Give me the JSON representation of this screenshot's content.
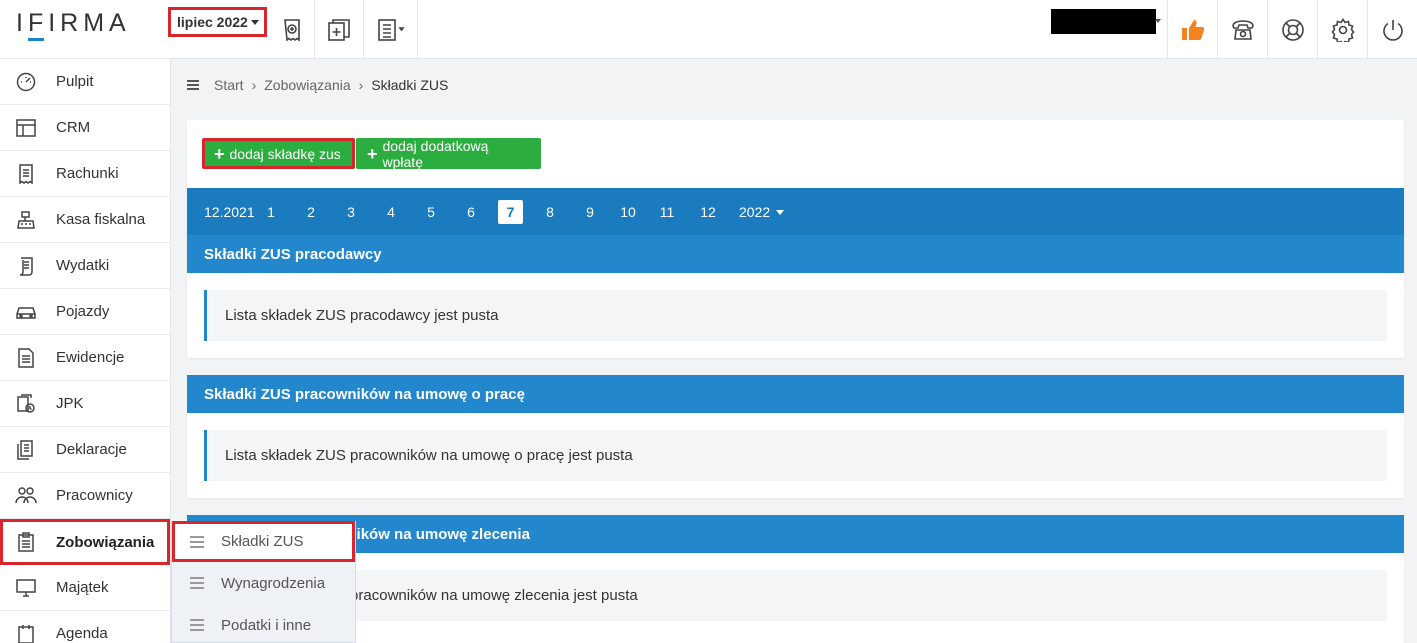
{
  "brand": {
    "logo_text": "IFIRMA"
  },
  "header": {
    "month_label": "lipiec 2022",
    "icons": [
      "receipt-add-icon",
      "document-plus-icon",
      "ledger-icon",
      "thumbs-up-icon",
      "telephone-icon",
      "lifebuoy-icon",
      "gear-icon",
      "power-icon"
    ],
    "accent_color": "#f58220"
  },
  "sidebar": {
    "items": [
      {
        "label": "Pulpit",
        "icon": "dashboard-icon"
      },
      {
        "label": "CRM",
        "icon": "crm-icon"
      },
      {
        "label": "Rachunki",
        "icon": "invoice-icon"
      },
      {
        "label": "Kasa fiskalna",
        "icon": "cash-register-icon"
      },
      {
        "label": "Wydatki",
        "icon": "receipt-icon"
      },
      {
        "label": "Pojazdy",
        "icon": "car-icon"
      },
      {
        "label": "Ewidencje",
        "icon": "records-icon"
      },
      {
        "label": "JPK",
        "icon": "jpk-icon"
      },
      {
        "label": "Deklaracje",
        "icon": "declaration-icon"
      },
      {
        "label": "Pracownicy",
        "icon": "employees-icon"
      },
      {
        "label": "Zobowiązania",
        "icon": "clipboard-icon"
      },
      {
        "label": "Majątek",
        "icon": "monitor-icon"
      },
      {
        "label": "Agenda",
        "icon": "agenda-icon"
      }
    ],
    "active_index": 10
  },
  "submenu": {
    "items": [
      "Składki ZUS",
      "Wynagrodzenia",
      "Podatki i inne"
    ],
    "selected": "Składki ZUS"
  },
  "breadcrumb": {
    "start": "Start",
    "middle": "Zobowiązania",
    "current": "Składki ZUS"
  },
  "actions": {
    "add_zus": "dodaj składkę zus",
    "add_payment": "dodaj dodatkową wpłatę"
  },
  "months": {
    "items": [
      "12.2021",
      "1",
      "2",
      "3",
      "4",
      "5",
      "6",
      "7",
      "8",
      "9",
      "10",
      "11",
      "12"
    ],
    "active": "7",
    "year": "2022"
  },
  "sections": [
    {
      "title": "Składki ZUS pracodawcy",
      "empty": "Lista składek ZUS pracodawcy jest pusta"
    },
    {
      "title": "Składki ZUS pracowników na umowę o pracę",
      "empty": "Lista składek ZUS pracowników na umowę o pracę jest pusta"
    },
    {
      "title": "Składki ZUS pracowników na umowę zlecenia",
      "empty": "Lista składek ZUS pracowników na umowę zlecenia jest pusta"
    }
  ],
  "colors": {
    "primary": "#1b7bbf",
    "section": "#2287cd",
    "success": "#2cad3f",
    "highlight": "#d9262c"
  }
}
